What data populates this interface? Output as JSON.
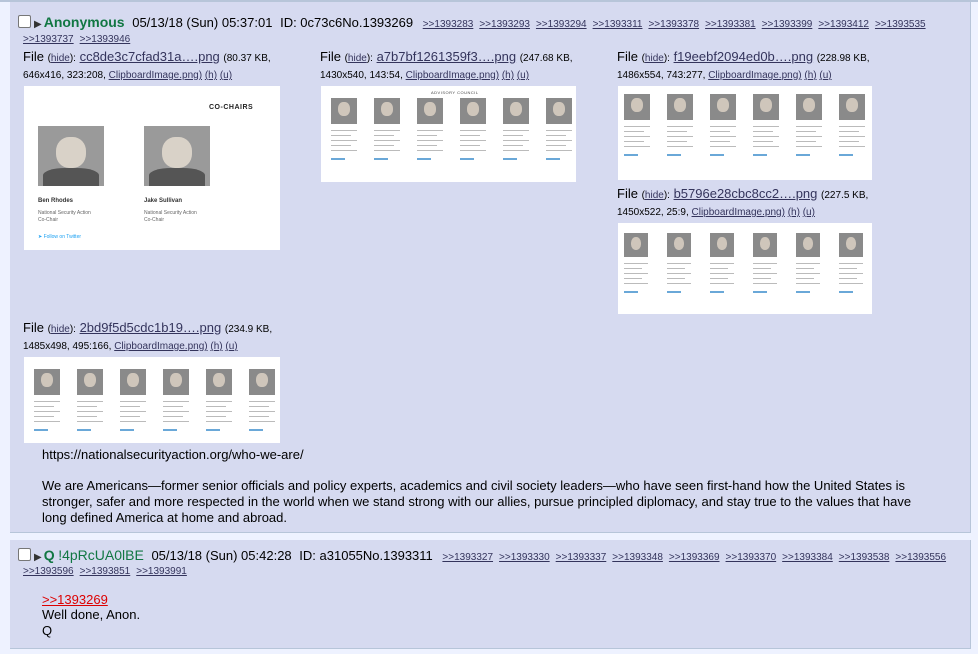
{
  "post1": {
    "name": "Anonymous",
    "datetime": "05/13/18 (Sun) 05:37:01",
    "id": "ID: 0c73c6",
    "number": "No.1393269",
    "backlinks": [
      ">>1393283",
      ">>1393293",
      ">>1393294",
      ">>1393311",
      ">>1393378",
      ">>1393381",
      ">>1393399",
      ">>1393412",
      ">>1393535"
    ],
    "backlinks2": [
      ">>1393737",
      ">>1393946"
    ],
    "files": [
      {
        "label": "File",
        "hide": "hide",
        "name": "cc8de3c7cfad31a….png",
        "size": "(80.37 KB,",
        "dims": "646x416, 323:208,",
        "orig": "ClipboardImage.png)",
        "h": "(h)",
        "u": "(u)"
      },
      {
        "label": "File",
        "hide": "hide",
        "name": "a7b7bf1261359f3….png",
        "size": "(247.68 KB,",
        "dims": "1430x540, 143:54,",
        "orig": "ClipboardImage.png)",
        "h": "(h)",
        "u": "(u)"
      },
      {
        "label": "File",
        "hide": "hide",
        "name": "f19eebf2094ed0b….png",
        "size": "(228.98 KB,",
        "dims": "1486x554, 743:277,",
        "orig": "ClipboardImage.png)",
        "h": "(h)",
        "u": "(u)"
      },
      {
        "label": "File",
        "hide": "hide",
        "name": "b5796e28cbc8cc2….png",
        "size": "(227.5 KB,",
        "dims": "1450x522, 25:9,",
        "orig": "ClipboardImage.png)",
        "h": "(h)",
        "u": "(u)"
      },
      {
        "label": "File",
        "hide": "hide",
        "name": "2bd9f5d5cdc1b19….png",
        "size": "(234.9 KB,",
        "dims": "1485x498, 495:166,",
        "orig": "ClipboardImage.png)",
        "h": "(h)",
        "u": "(u)"
      }
    ],
    "thumb1": {
      "title": "CO-CHAIRS",
      "person1": {
        "name": "Ben Rhodes",
        "line1": "National Security Action",
        "line2": "Co-Chair"
      },
      "person2": {
        "name": "Jake Sullivan",
        "line1": "National Security Action",
        "line2": "Co-Chair"
      },
      "twitter": "Follow on Twitter"
    },
    "thumb2": {
      "title": "ADVISORY COUNCIL"
    },
    "url": "https://nationalsecurityaction.org/who-we-are/",
    "text": "We are Americans—former senior officials and policy experts, academics and civil society leaders—who have seen first-hand how the United States is stronger, safer and more respected in the world when we stand strong with our allies, pursue principled diplomacy, and stay true to the values that have long defined America at home and abroad."
  },
  "post2": {
    "name": "Q",
    "tripcode": "!4pRcUA0lBE",
    "datetime": "05/13/18 (Sun) 05:42:28",
    "id": "ID: a31055",
    "number": "No.1393311",
    "backlinks": [
      ">>1393327",
      ">>1393330",
      ">>1393337",
      ">>1393348",
      ">>1393369",
      ">>1393370",
      ">>1393384",
      ">>1393538",
      ">>1393556"
    ],
    "backlinks2": [
      ">>1393596",
      ">>1393851",
      ">>1393991"
    ],
    "quote": ">>1393269",
    "line1": "Well done, Anon.",
    "line2": "Q"
  },
  "colors": {
    "bg": "#eef2ff",
    "post_bg": "#d6daf0",
    "name": "#117743",
    "link": "#34345c",
    "quote": "#dd0000"
  }
}
